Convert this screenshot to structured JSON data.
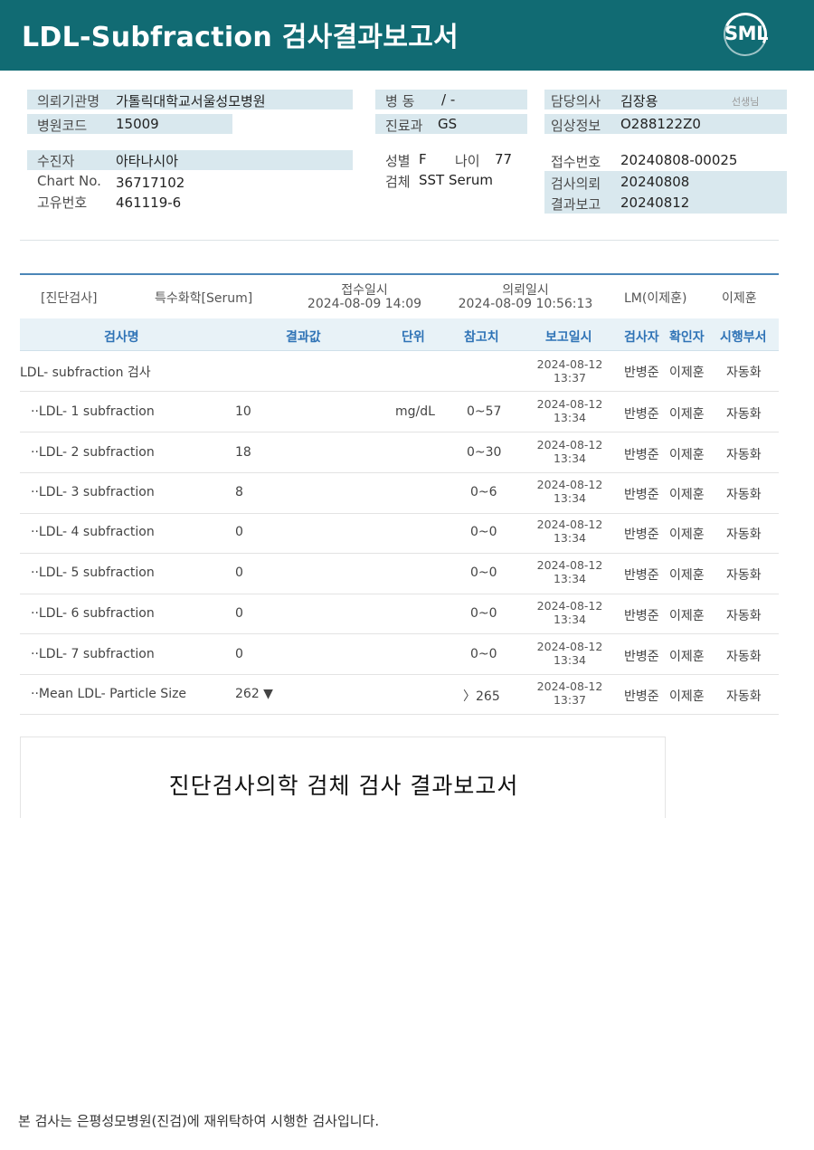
{
  "header": {
    "title": "LDL-Subfraction 검사결과보고서",
    "logo_text": "SML",
    "background": "#116b73"
  },
  "info": {
    "institution_label": "의뢰기관명",
    "institution_value": "가톨릭대학교서울성모병원",
    "hospital_code_label": "병원코드",
    "hospital_code_value": "15009",
    "ward_label": "병 동",
    "ward_value": "/ -",
    "department_label": "진료과",
    "department_value": "GS",
    "doctor_label": "담당의사",
    "doctor_value": "김장용",
    "doctor_suffix": "선생님",
    "clinical_label": "임상정보",
    "clinical_value": "O288122Z0",
    "patient_label": "수진자",
    "patient_value": "아타나시아",
    "chart_label": "Chart No.",
    "chart_value": "36717102",
    "unique_label": "고유번호",
    "unique_value": "461119-6",
    "sex_label": "성별",
    "sex_value": "F",
    "age_label": "나이",
    "age_value": "77",
    "specimen_label": "검체",
    "specimen_value": "SST Serum",
    "receipt_label": "접수번호",
    "receipt_value": "20240808-00025",
    "request_label": "검사의뢰",
    "request_value": "20240808",
    "report_label": "결과보고",
    "report_value": "20240812"
  },
  "results": {
    "category": "[진단검사]",
    "test_group": "특수화학[Serum]",
    "received_label": "접수일시",
    "received_value": "2024-08-09 14:09",
    "requested_label": "의뢰일시",
    "requested_value": "2024-08-09 10:56:13",
    "lm_label": "LM(이제훈)",
    "lm_name": "이제훈",
    "columns": [
      "검사명",
      "결과값",
      "단위",
      "참고치",
      "보고일시",
      "검사자",
      "확인자",
      "시행부서"
    ],
    "rows": [
      {
        "name": "LDL- subfraction 검사",
        "result": "",
        "unit": "",
        "ref": "",
        "date": "2024-08-12",
        "time": "13:37",
        "tester": "반병준",
        "confirmer": "이제훈",
        "dept": "자동화"
      },
      {
        "name": "··LDL- 1 subfraction",
        "result": "10",
        "unit": "mg/dL",
        "ref": "0~57",
        "date": "2024-08-12",
        "time": "13:34",
        "tester": "반병준",
        "confirmer": "이제훈",
        "dept": "자동화"
      },
      {
        "name": "··LDL- 2 subfraction",
        "result": "18",
        "unit": "",
        "ref": "0~30",
        "date": "2024-08-12",
        "time": "13:34",
        "tester": "반병준",
        "confirmer": "이제훈",
        "dept": "자동화"
      },
      {
        "name": "··LDL- 3 subfraction",
        "result": "8",
        "unit": "",
        "ref": "0~6",
        "date": "2024-08-12",
        "time": "13:34",
        "tester": "반병준",
        "confirmer": "이제훈",
        "dept": "자동화"
      },
      {
        "name": "··LDL- 4 subfraction",
        "result": "0",
        "unit": "",
        "ref": "0~0",
        "date": "2024-08-12",
        "time": "13:34",
        "tester": "반병준",
        "confirmer": "이제훈",
        "dept": "자동화"
      },
      {
        "name": "··LDL- 5 subfraction",
        "result": "0",
        "unit": "",
        "ref": "0~0",
        "date": "2024-08-12",
        "time": "13:34",
        "tester": "반병준",
        "confirmer": "이제훈",
        "dept": "자동화"
      },
      {
        "name": "··LDL- 6 subfraction",
        "result": "0",
        "unit": "",
        "ref": "0~0",
        "date": "2024-08-12",
        "time": "13:34",
        "tester": "반병준",
        "confirmer": "이제훈",
        "dept": "자동화"
      },
      {
        "name": "··LDL- 7 subfraction",
        "result": "0",
        "unit": "",
        "ref": "0~0",
        "date": "2024-08-12",
        "time": "13:34",
        "tester": "반병준",
        "confirmer": "이제훈",
        "dept": "자동화"
      },
      {
        "name": "··Mean LDL- Particle Size",
        "result": "262 ▼",
        "unit": "",
        "ref": "〉265",
        "date": "2024-08-12",
        "time": "13:37",
        "tester": "반병준",
        "confirmer": "이제훈",
        "dept": "자동화"
      }
    ]
  },
  "preview": {
    "title": "진단검사의학 검체 검사 결과보고서"
  },
  "footer": {
    "note": "본 검사는 은평성모병원(진검)에 재위탁하여 시행한 검사입니다."
  }
}
